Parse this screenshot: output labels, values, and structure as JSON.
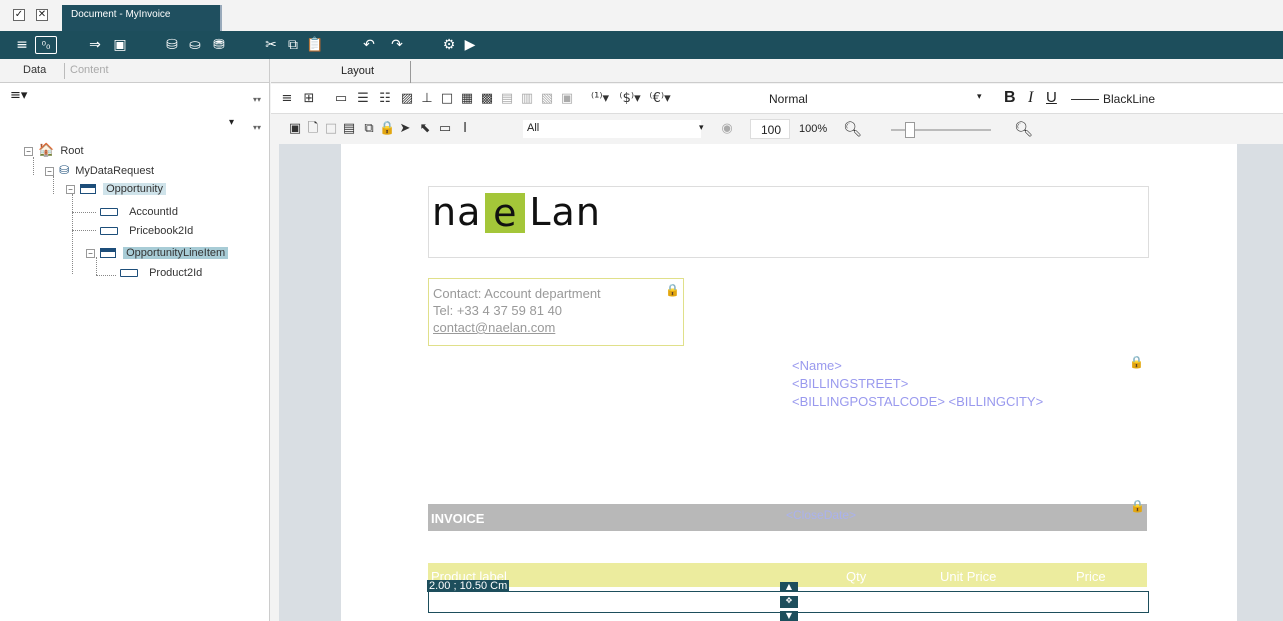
{
  "window": {
    "checkbox_glyph": "✓",
    "close_glyph": "✕",
    "document_tab": "Document - MyInvoice"
  },
  "left_panel": {
    "tabs": [
      "Data",
      "Content"
    ],
    "tree": {
      "root": "Root",
      "request": "MyDataRequest",
      "opportunity": "Opportunity",
      "account": "AccountId",
      "pricebook": "Pricebook2Id",
      "line_item": "OpportunityLineItem",
      "product": "Product2Id"
    }
  },
  "layout_tab": "Layout",
  "format_toolbar": {
    "style_value": "Normal",
    "bold": "B",
    "italic": "I",
    "underline": "U",
    "line_style": "BlackLine"
  },
  "selection_toolbar": {
    "filter_value": "All",
    "zoom_value": "100",
    "zoom_pct": "100%"
  },
  "canvas": {
    "logo": {
      "left": "na",
      "mid": "e",
      "right": "Lan"
    },
    "contact": {
      "line1": "Contact: Account department",
      "line2": "Tel: +33 4 37 59 81 40",
      "email": "contact@naelan.com"
    },
    "address": {
      "line1": "<Name>",
      "line2": "<BILLINGSTREET>",
      "line3": "<BILLINGPOSTALCODE> <BILLINGCITY>"
    },
    "invoice": {
      "title": "INVOICE",
      "date": "<CloseDate>"
    },
    "product_header": {
      "label": "Product label",
      "qty": "Qty",
      "unit_price": "Unit Price",
      "price": "Price"
    },
    "cursor_label": "2.00 ; 10.50 Cm"
  }
}
